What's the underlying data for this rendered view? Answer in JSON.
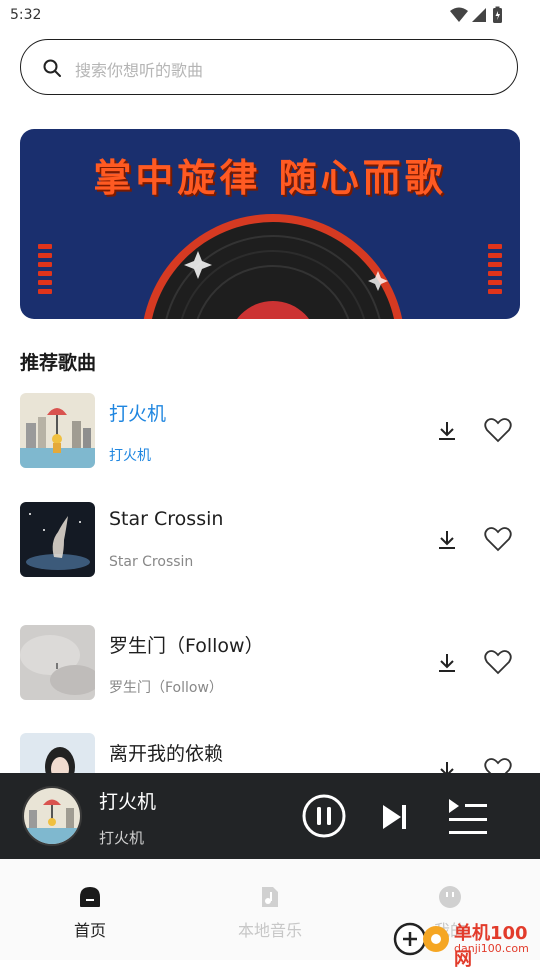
{
  "status_bar": {
    "time": "5:32"
  },
  "search": {
    "placeholder": "搜索你想听的歌曲"
  },
  "banner": {
    "title": "掌中旋律 随心而歌"
  },
  "recommend": {
    "title": "推荐歌曲",
    "songs": [
      {
        "name": "打火机",
        "artist": "打火机",
        "active": true
      },
      {
        "name": "Star Crossin",
        "artist": "Star Crossin",
        "active": false
      },
      {
        "name": "罗生门（Follow）",
        "artist": "罗生门（Follow）",
        "active": false
      },
      {
        "name": "离开我的依赖",
        "artist": "",
        "active": false
      }
    ]
  },
  "player": {
    "title": "打火机",
    "artist": "打火机"
  },
  "tabs": [
    {
      "label": "首页",
      "icon": "home-icon",
      "active": true
    },
    {
      "label": "本地音乐",
      "icon": "local-music-icon",
      "active": false
    },
    {
      "label": "我的",
      "icon": "profile-icon",
      "active": false
    }
  ],
  "watermark": {
    "text": "单机100网",
    "url": "danji100.com"
  },
  "colors": {
    "accent": "#1f86e0",
    "player_bg": "#222426",
    "banner_bg": "#1a2f6e",
    "banner_text": "#ff5a22"
  }
}
